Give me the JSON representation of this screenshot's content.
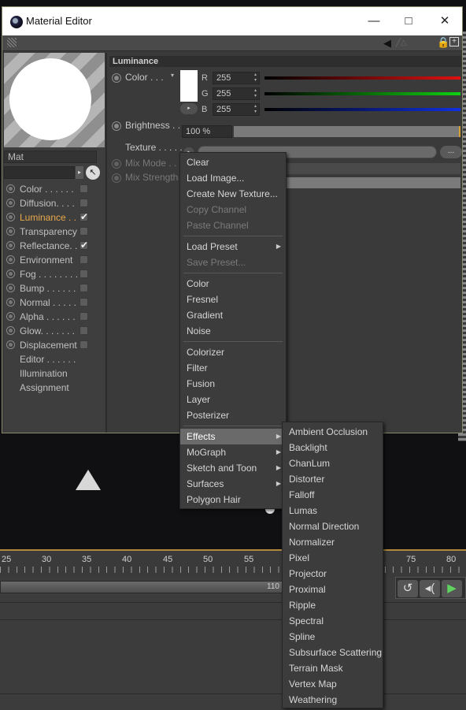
{
  "window": {
    "title": "Material Editor"
  },
  "material": {
    "name": "Mat"
  },
  "channels": [
    {
      "label": "Color . . . . . .",
      "checked": false
    },
    {
      "label": "Diffusion. . . .",
      "checked": false
    },
    {
      "label": "Luminance . .",
      "checked": true,
      "active": true
    },
    {
      "label": "Transparency",
      "checked": false
    },
    {
      "label": "Reflectance. .",
      "checked": true
    },
    {
      "label": "Environment",
      "checked": false
    },
    {
      "label": "Fog . . . . . . . .",
      "checked": false
    },
    {
      "label": "Bump . . . . . .",
      "checked": false
    },
    {
      "label": "Normal . . . . .",
      "checked": false
    },
    {
      "label": "Alpha . . . . . .",
      "checked": false
    },
    {
      "label": "Glow. . . . . . .",
      "checked": false
    },
    {
      "label": "Displacement",
      "checked": false
    }
  ],
  "extra_items": [
    "Editor . . . . . .",
    "Illumination",
    "Assignment"
  ],
  "luminance": {
    "section_title": "Luminance",
    "color_label": "Color . . .",
    "r_label": "R",
    "r_value": "255",
    "g_label": "G",
    "g_value": "255",
    "b_label": "B",
    "b_value": "255",
    "brightness_label": "Brightness . .",
    "brightness_value": "100 %",
    "texture_label": "Texture . . . . .",
    "texture_more": "...",
    "mix_mode_label": "Mix Mode . .",
    "mix_strength_label": "Mix Strength"
  },
  "timeline": {
    "ruler": [
      "25",
      "30",
      "35",
      "40",
      "45",
      "50",
      "55",
      "75",
      "80"
    ],
    "frame_value": "110"
  },
  "context_menu": {
    "group1": [
      "Clear",
      "Load Image...",
      "Create New Texture...",
      "Copy Channel",
      "Paste Channel"
    ],
    "group2": [
      "Load Preset",
      "Save Preset..."
    ],
    "group3": [
      "Color",
      "Fresnel",
      "Gradient",
      "Noise"
    ],
    "group4": [
      "Colorizer",
      "Filter",
      "Fusion",
      "Layer",
      "Posterizer"
    ],
    "group5": [
      "Effects",
      "MoGraph",
      "Sketch and Toon",
      "Surfaces",
      "Polygon Hair"
    ]
  },
  "effects_menu": [
    "Ambient Occlusion",
    "Backlight",
    "ChanLum",
    "Distorter",
    "Falloff",
    "Lumas",
    "Normal Direction",
    "Normalizer",
    "Pixel",
    "Projector",
    "Proximal",
    "Ripple",
    "Spectral",
    "Spline",
    "Subsurface Scattering",
    "Terrain Mask",
    "Vertex Map",
    "Weathering"
  ],
  "icons": {
    "app": "cinema4d-icon",
    "minimize": "minimize-icon",
    "maximize": "maximize-icon",
    "close": "close-icon",
    "submenu": "chevron-right-icon",
    "picker": "arrow-cursor-icon"
  },
  "colors": {
    "accent": "#e8a84a",
    "timeline_line": "#b08a3a",
    "play": "#5fd35f"
  }
}
